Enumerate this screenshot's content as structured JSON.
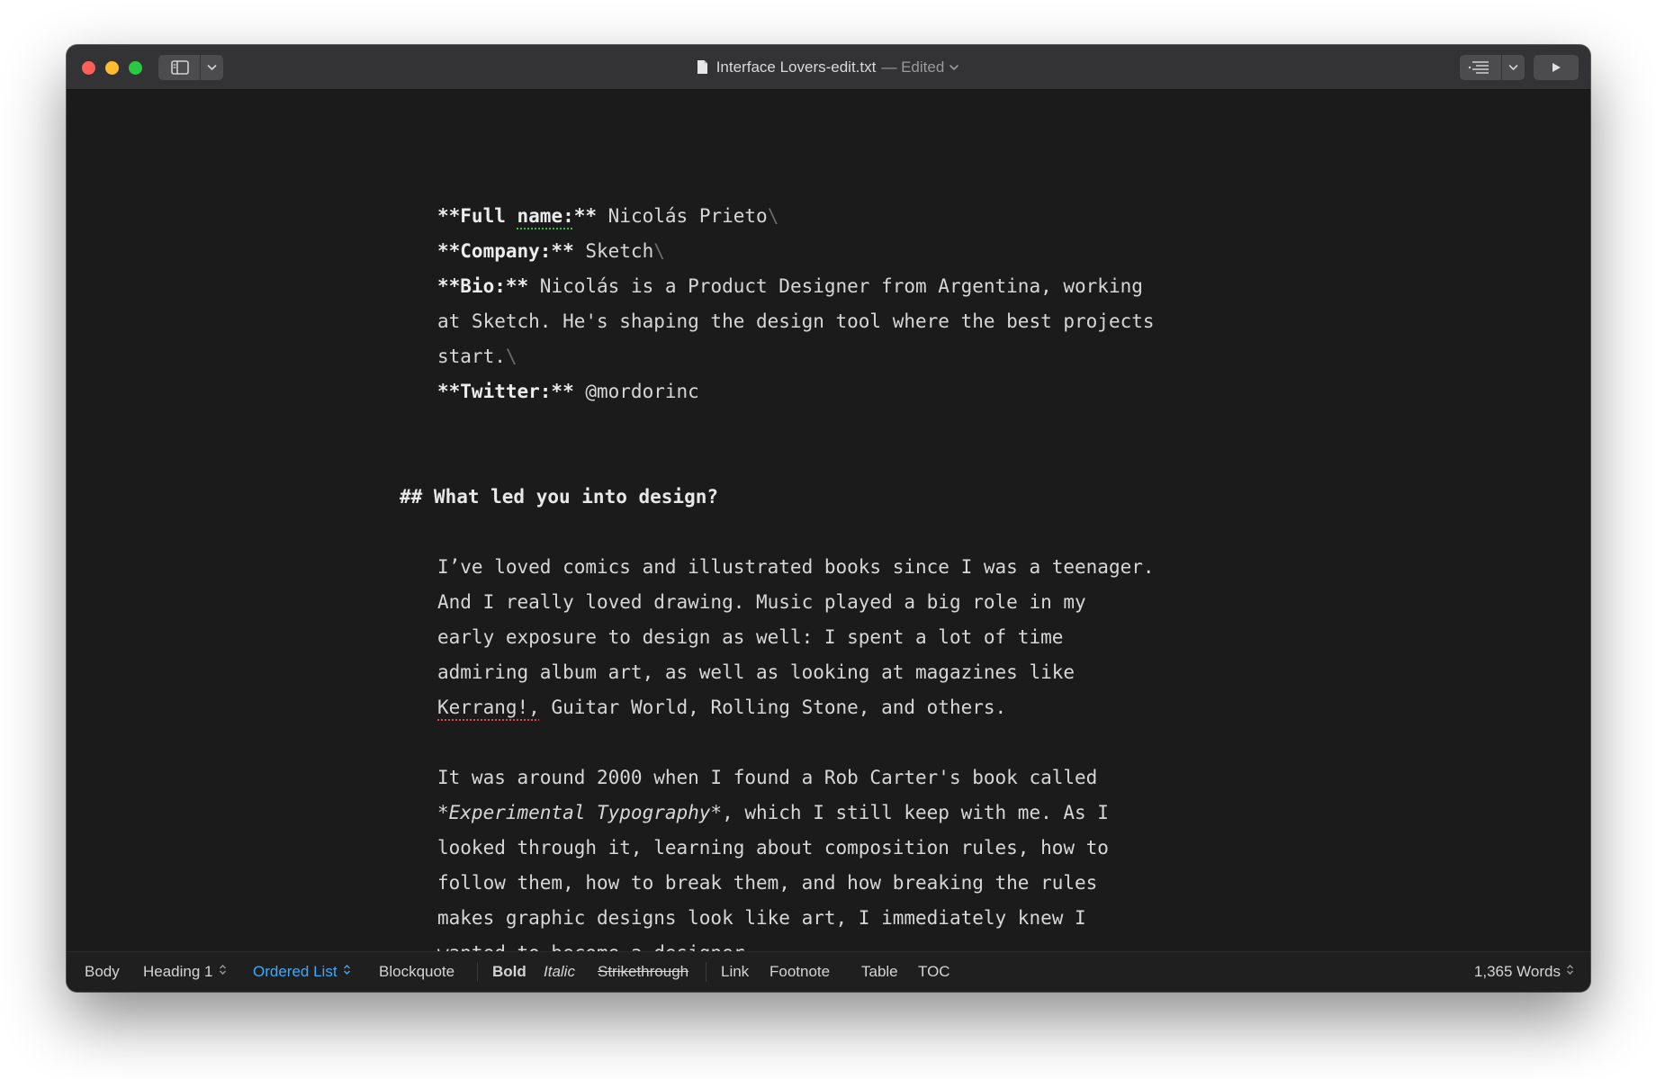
{
  "window": {
    "filename": "Interface Lovers-edit.txt",
    "status": "— Edited"
  },
  "content": {
    "fullname_label": "**Full name:**",
    "fullname_label_pre": "**Full ",
    "fullname_label_word": "name:",
    "fullname_label_post": "**",
    "fullname_value": " Nicolás Prieto",
    "company_label": "**Company:**",
    "company_value": " Sketch",
    "bio_label": "**Bio:**",
    "bio_line1": " Nicolás is a Product Designer from Argentina, working",
    "bio_line2": "at Sketch. He's shaping the design tool where the best projects",
    "bio_line3": "start.",
    "twitter_label": "**Twitter:**",
    "twitter_value": " @mordorinc",
    "line_break": "\\",
    "heading": "## What led you into design?",
    "p1": [
      "I’ve loved comics and illustrated books since I was a teenager.",
      "And I really loved drawing. Music played a big role in my",
      "early exposure to design as well: I spent a lot of time",
      "admiring album art, as well as looking at magazines like"
    ],
    "p1_last_word": "Kerrang!,",
    "p1_last_rest": " Guitar World, Rolling Stone, and others.",
    "p2": [
      "It was around 2000 when I found a Rob Carter's book called",
      "*Experimental Typography*",
      ", which I still keep with me. As I",
      "looked through it, learning about composition rules, how to",
      "follow them, how to break them, and how breaking the rules",
      "makes graphic designs look like art, I immediately knew I",
      "wanted to become a designer."
    ]
  },
  "footer": {
    "body": "Body",
    "heading1": "Heading 1",
    "ordered_list": "Ordered List",
    "blockquote": "Blockquote",
    "bold": "Bold",
    "italic": "Italic",
    "strikethrough": "Strikethrough",
    "link": "Link",
    "footnote": "Footnote",
    "table": "Table",
    "toc": "TOC",
    "word_count": "1,365 Words",
    "accent_color": "#3fa9f5"
  },
  "icons": {
    "sidebar_toggle": "sidebar-icon",
    "chevron": "chevron-down-icon",
    "outline": "outline-list-icon",
    "preview": "play-icon",
    "updown": "updown-arrows-icon",
    "document": "document-icon"
  }
}
